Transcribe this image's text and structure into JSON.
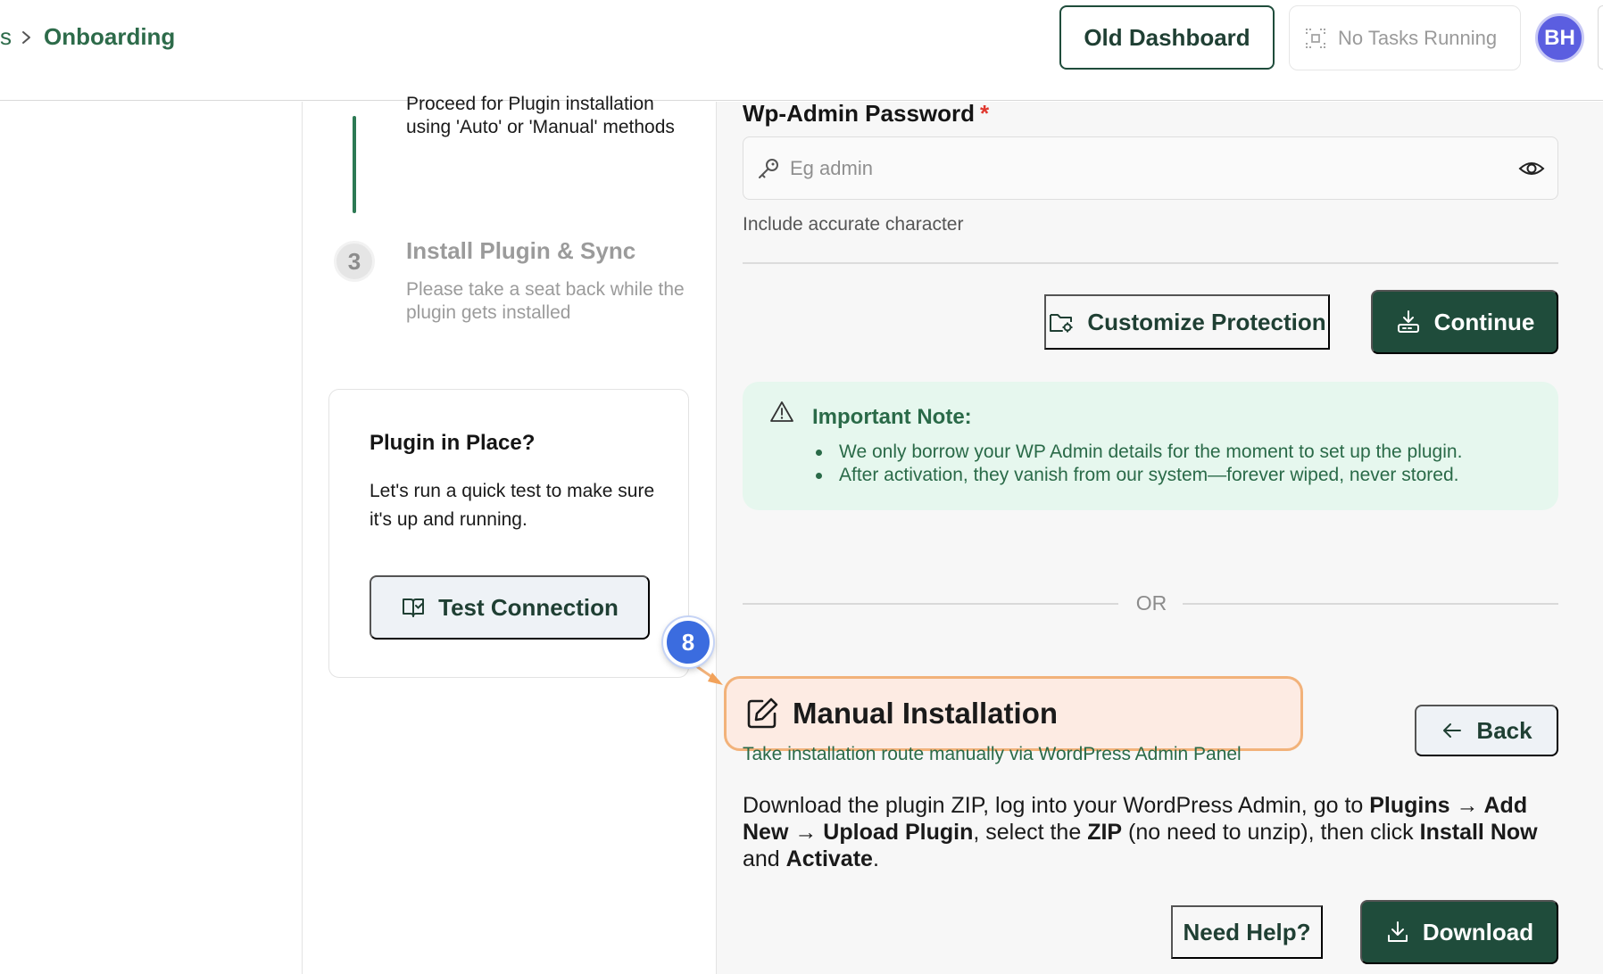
{
  "breadcrumb": {
    "prev_fragment": "s",
    "current": "Onboarding"
  },
  "header": {
    "old_dashboard_label": "Old Dashboard",
    "tasks_status": "No Tasks Running",
    "avatar_initials": "BH"
  },
  "steps": {
    "step2_description": "Proceed for Plugin installation using 'Auto' or 'Manual' methods",
    "step3": {
      "number": "3",
      "title": "Install Plugin & Sync",
      "description": "Please take a seat back while the plugin gets installed"
    }
  },
  "plugin_card": {
    "title": "Plugin in Place?",
    "description": "Let's run a quick test to make sure it's up and running.",
    "button_label": "Test Connection"
  },
  "password_field": {
    "label": "Wp-Admin Password",
    "required_mark": "*",
    "placeholder": "Eg admin",
    "hint": "Include accurate character"
  },
  "actions": {
    "customize_label": "Customize Protection",
    "continue_label": "Continue"
  },
  "important_note": {
    "title": "Important Note:",
    "items": [
      "We only borrow your WP Admin details for the moment to set up the plugin.",
      "After activation, they vanish from our system—forever wiped, never stored."
    ]
  },
  "divider": {
    "or_text": "OR"
  },
  "manual": {
    "title": "Manual Installation",
    "subtitle": "Take installation route manually via WordPress Admin Panel",
    "back_label": "Back",
    "desc": {
      "t1": "Download the plugin ZIP, log into your WordPress Admin, go to ",
      "b1": "Plugins → Add New → Upload Plugin",
      "t2": ", select the ",
      "b2": "ZIP",
      "t3": " (no need to unzip), then click ",
      "b3": "Install Now",
      "t4": " and ",
      "b4": "Activate",
      "t5": "."
    },
    "help_label": "Need Help?",
    "download_label": "Download"
  },
  "tutorial_marker": {
    "number": "8"
  },
  "colors": {
    "brand_dark_green": "#1f4c3b",
    "link_green": "#2d6b4a",
    "note_bg": "#e6f7ee",
    "highlight_border": "#f2b27a",
    "marker_blue": "#3b6cdf",
    "required_red": "#e0372e"
  },
  "icons": {
    "breadcrumb_separator": "chevron-right-icon",
    "tasks": "task-frame-icon",
    "password_prefix": "key-icon",
    "password_toggle": "eye-icon",
    "customize": "folder-gear-icon",
    "continue": "install-tray-icon",
    "note": "warning-triangle-icon",
    "manual": "edit-pencil-icon",
    "back": "arrow-left-icon",
    "download": "download-icon",
    "test": "book-check-icon"
  }
}
